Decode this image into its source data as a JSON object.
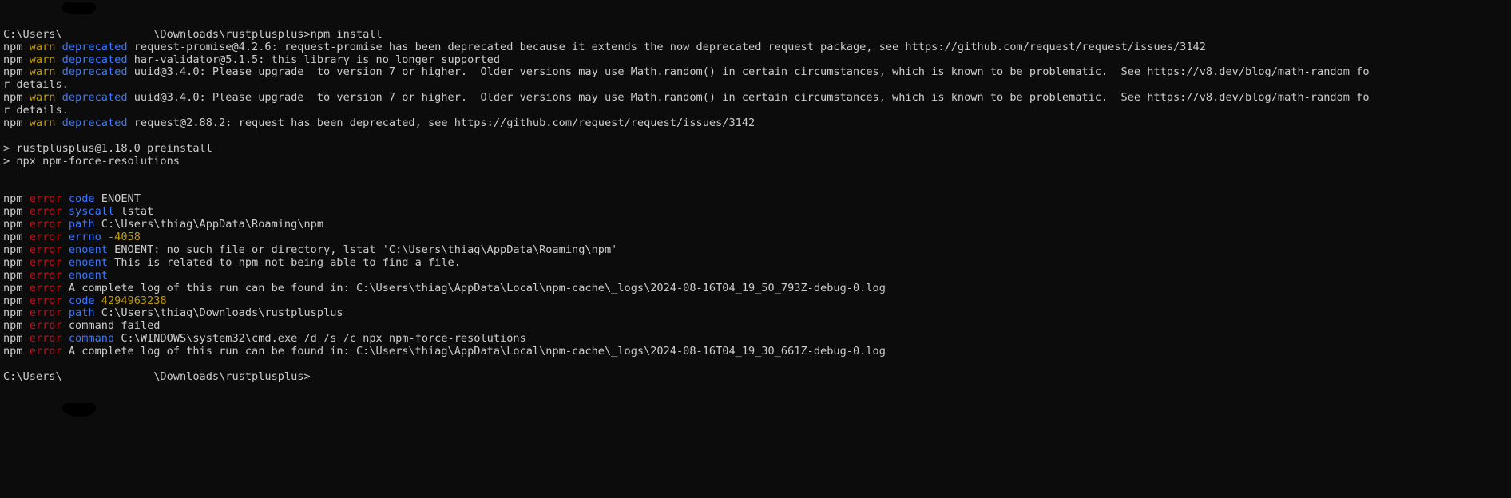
{
  "terminal": {
    "app": "Windows Command Prompt",
    "background_color": "#0c0c0c",
    "foreground_color": "#cccccc",
    "colors": {
      "white": "#cccccc",
      "red": "#c50f1f",
      "yellow": "#c19c00",
      "blue": "#3b78ff",
      "redaction": "#000000"
    },
    "prompt_prefix": "C:\\Users\\",
    "prompt_suffix": "\\Downloads\\rustplusplus>",
    "redacted_username": "",
    "command": "npm install",
    "lines": [
      {
        "id": "prompt-command",
        "segments": [
          {
            "text": "C:\\Users\\",
            "color": "white"
          },
          {
            "text": "              ",
            "color": "redacted"
          },
          {
            "text": "\\Downloads\\rustplusplus>npm install",
            "color": "white"
          }
        ]
      },
      {
        "id": "warn-request-promise",
        "segments": [
          {
            "text": "npm ",
            "color": "white"
          },
          {
            "text": "warn ",
            "color": "yellow"
          },
          {
            "text": "deprecated ",
            "color": "blue"
          },
          {
            "text": "request-promise@4.2.6: request-promise has been deprecated because it extends the now deprecated request package, see https://github.com/request/request/issues/3142",
            "color": "white"
          }
        ]
      },
      {
        "id": "warn-har-validator",
        "segments": [
          {
            "text": "npm ",
            "color": "white"
          },
          {
            "text": "warn ",
            "color": "yellow"
          },
          {
            "text": "deprecated ",
            "color": "blue"
          },
          {
            "text": "har-validator@5.1.5: this library is no longer supported",
            "color": "white"
          }
        ]
      },
      {
        "id": "warn-uuid-1",
        "segments": [
          {
            "text": "npm ",
            "color": "white"
          },
          {
            "text": "warn ",
            "color": "yellow"
          },
          {
            "text": "deprecated ",
            "color": "blue"
          },
          {
            "text": "uuid@3.4.0: Please upgrade  to version 7 or higher.  Older versions may use Math.random() in certain circumstances, which is known to be problematic.  See https://v8.dev/blog/math-random fo",
            "color": "white"
          }
        ]
      },
      {
        "id": "warn-uuid-1-wrap",
        "segments": [
          {
            "text": "r details.",
            "color": "white"
          }
        ]
      },
      {
        "id": "warn-uuid-2",
        "segments": [
          {
            "text": "npm ",
            "color": "white"
          },
          {
            "text": "warn ",
            "color": "yellow"
          },
          {
            "text": "deprecated ",
            "color": "blue"
          },
          {
            "text": "uuid@3.4.0: Please upgrade  to version 7 or higher.  Older versions may use Math.random() in certain circumstances, which is known to be problematic.  See https://v8.dev/blog/math-random fo",
            "color": "white"
          }
        ]
      },
      {
        "id": "warn-uuid-2-wrap",
        "segments": [
          {
            "text": "r details.",
            "color": "white"
          }
        ]
      },
      {
        "id": "warn-request",
        "segments": [
          {
            "text": "npm ",
            "color": "white"
          },
          {
            "text": "warn ",
            "color": "yellow"
          },
          {
            "text": "deprecated ",
            "color": "blue"
          },
          {
            "text": "request@2.88.2: request has been deprecated, see https://github.com/request/request/issues/3142",
            "color": "white"
          }
        ]
      },
      {
        "id": "blank-1",
        "segments": []
      },
      {
        "id": "script-preinstall",
        "segments": [
          {
            "text": "> rustplusplus@1.18.0 preinstall",
            "color": "white"
          }
        ]
      },
      {
        "id": "script-npx",
        "segments": [
          {
            "text": "> npx npm-force-resolutions",
            "color": "white"
          }
        ]
      },
      {
        "id": "blank-2",
        "segments": []
      },
      {
        "id": "blank-3",
        "segments": []
      },
      {
        "id": "error-code-enoent",
        "segments": [
          {
            "text": "npm ",
            "color": "white"
          },
          {
            "text": "error ",
            "color": "red"
          },
          {
            "text": "code ",
            "color": "blue"
          },
          {
            "text": "ENOENT",
            "color": "white"
          }
        ]
      },
      {
        "id": "error-syscall",
        "segments": [
          {
            "text": "npm ",
            "color": "white"
          },
          {
            "text": "error ",
            "color": "red"
          },
          {
            "text": "syscall ",
            "color": "blue"
          },
          {
            "text": "lstat",
            "color": "white"
          }
        ]
      },
      {
        "id": "error-path-roaming",
        "segments": [
          {
            "text": "npm ",
            "color": "white"
          },
          {
            "text": "error ",
            "color": "red"
          },
          {
            "text": "path ",
            "color": "blue"
          },
          {
            "text": "C:\\Users\\thiag\\AppData\\Roaming\\npm",
            "color": "white"
          }
        ]
      },
      {
        "id": "error-errno",
        "segments": [
          {
            "text": "npm ",
            "color": "white"
          },
          {
            "text": "error ",
            "color": "red"
          },
          {
            "text": "errno ",
            "color": "blue"
          },
          {
            "text": "-4058",
            "color": "yellow"
          }
        ]
      },
      {
        "id": "error-enoent-detail",
        "segments": [
          {
            "text": "npm ",
            "color": "white"
          },
          {
            "text": "error ",
            "color": "red"
          },
          {
            "text": "enoent ",
            "color": "blue"
          },
          {
            "text": "ENOENT: no such file or directory, lstat 'C:\\Users\\thiag\\AppData\\Roaming\\npm'",
            "color": "white"
          }
        ]
      },
      {
        "id": "error-enoent-related",
        "segments": [
          {
            "text": "npm ",
            "color": "white"
          },
          {
            "text": "error ",
            "color": "red"
          },
          {
            "text": "enoent ",
            "color": "blue"
          },
          {
            "text": "This is related to npm not being able to find a file.",
            "color": "white"
          }
        ]
      },
      {
        "id": "error-enoent-blank",
        "segments": [
          {
            "text": "npm ",
            "color": "white"
          },
          {
            "text": "error ",
            "color": "red"
          },
          {
            "text": "enoent",
            "color": "blue"
          }
        ]
      },
      {
        "id": "error-log-1",
        "segments": [
          {
            "text": "npm ",
            "color": "white"
          },
          {
            "text": "error ",
            "color": "red"
          },
          {
            "text": "A complete log of this run can be found in: C:\\Users\\thiag\\AppData\\Local\\npm-cache\\_logs\\2024-08-16T04_19_50_793Z-debug-0.log",
            "color": "white"
          }
        ]
      },
      {
        "id": "error-code-4294963238",
        "segments": [
          {
            "text": "npm ",
            "color": "white"
          },
          {
            "text": "error ",
            "color": "red"
          },
          {
            "text": "code ",
            "color": "blue"
          },
          {
            "text": "4294963238",
            "color": "yellow"
          }
        ]
      },
      {
        "id": "error-path-downloads",
        "segments": [
          {
            "text": "npm ",
            "color": "white"
          },
          {
            "text": "error ",
            "color": "red"
          },
          {
            "text": "path ",
            "color": "blue"
          },
          {
            "text": "C:\\Users\\thiag\\Downloads\\rustplusplus",
            "color": "white"
          }
        ]
      },
      {
        "id": "error-command-failed",
        "segments": [
          {
            "text": "npm ",
            "color": "white"
          },
          {
            "text": "error ",
            "color": "red"
          },
          {
            "text": "command failed",
            "color": "white"
          }
        ]
      },
      {
        "id": "error-command",
        "segments": [
          {
            "text": "npm ",
            "color": "white"
          },
          {
            "text": "error ",
            "color": "red"
          },
          {
            "text": "command ",
            "color": "blue"
          },
          {
            "text": "C:\\WINDOWS\\system32\\cmd.exe /d /s /c npx npm-force-resolutions",
            "color": "white"
          }
        ]
      },
      {
        "id": "error-log-2",
        "segments": [
          {
            "text": "npm ",
            "color": "white"
          },
          {
            "text": "error ",
            "color": "red"
          },
          {
            "text": "A complete log of this run can be found in: C:\\Users\\thiag\\AppData\\Local\\npm-cache\\_logs\\2024-08-16T04_19_30_661Z-debug-0.log",
            "color": "white"
          }
        ]
      },
      {
        "id": "blank-4",
        "segments": []
      },
      {
        "id": "final-prompt",
        "segments": [
          {
            "text": "C:\\Users\\",
            "color": "white"
          },
          {
            "text": "              ",
            "color": "redacted"
          },
          {
            "text": "\\Downloads\\rustplusplus>",
            "color": "white"
          }
        ],
        "cursor": true
      }
    ]
  }
}
